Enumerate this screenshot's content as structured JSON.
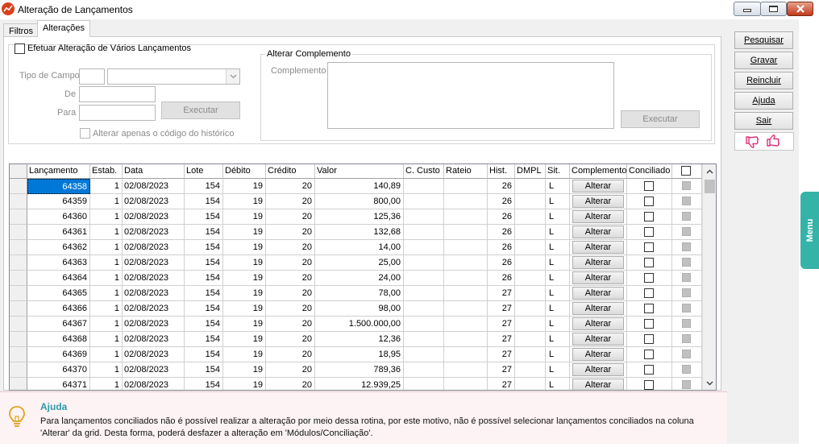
{
  "window": {
    "title": "Alteração de Lançamentos"
  },
  "tabs": [
    {
      "label": "Filtros"
    },
    {
      "label": "Alterações"
    }
  ],
  "form": {
    "multi_checkbox_label": "Efetuar Alteração de Vários Lançamentos",
    "tipo_campo_label": "Tipo de Campo",
    "de_label": "De",
    "para_label": "Para",
    "executar_label": "Executar",
    "historico_checkbox_label": "Alterar apenas o código do histórico",
    "complemento_group_title": "Alterar Complemento",
    "complemento_label": "Complemento",
    "complemento_executar_label": "Executar"
  },
  "grid": {
    "headers": [
      "Lançamento",
      "Estab.",
      "Data",
      "Lote",
      "Débito",
      "Crédito",
      "Valor",
      "C. Custo",
      "Rateio",
      "Hist.",
      "DMPL",
      "Sit.",
      "Complemento",
      "Conciliado"
    ],
    "alterar_label": "Alterar",
    "rows": [
      {
        "lanc": "64358",
        "estab": "1",
        "data": "02/08/2023",
        "lote": "154",
        "debito": "19",
        "credito": "20",
        "valor": "140,89",
        "hist": "26",
        "sit": "L"
      },
      {
        "lanc": "64359",
        "estab": "1",
        "data": "02/08/2023",
        "lote": "154",
        "debito": "19",
        "credito": "20",
        "valor": "800,00",
        "hist": "26",
        "sit": "L"
      },
      {
        "lanc": "64360",
        "estab": "1",
        "data": "02/08/2023",
        "lote": "154",
        "debito": "19",
        "credito": "20",
        "valor": "125,36",
        "hist": "26",
        "sit": "L"
      },
      {
        "lanc": "64361",
        "estab": "1",
        "data": "02/08/2023",
        "lote": "154",
        "debito": "19",
        "credito": "20",
        "valor": "132,68",
        "hist": "26",
        "sit": "L"
      },
      {
        "lanc": "64362",
        "estab": "1",
        "data": "02/08/2023",
        "lote": "154",
        "debito": "19",
        "credito": "20",
        "valor": "14,00",
        "hist": "26",
        "sit": "L"
      },
      {
        "lanc": "64363",
        "estab": "1",
        "data": "02/08/2023",
        "lote": "154",
        "debito": "19",
        "credito": "20",
        "valor": "25,00",
        "hist": "26",
        "sit": "L"
      },
      {
        "lanc": "64364",
        "estab": "1",
        "data": "02/08/2023",
        "lote": "154",
        "debito": "19",
        "credito": "20",
        "valor": "24,00",
        "hist": "26",
        "sit": "L"
      },
      {
        "lanc": "64365",
        "estab": "1",
        "data": "02/08/2023",
        "lote": "154",
        "debito": "19",
        "credito": "20",
        "valor": "78,00",
        "hist": "27",
        "sit": "L"
      },
      {
        "lanc": "64366",
        "estab": "1",
        "data": "02/08/2023",
        "lote": "154",
        "debito": "19",
        "credito": "20",
        "valor": "98,00",
        "hist": "27",
        "sit": "L"
      },
      {
        "lanc": "64367",
        "estab": "1",
        "data": "02/08/2023",
        "lote": "154",
        "debito": "19",
        "credito": "20",
        "valor": "1.500.000,00",
        "hist": "27",
        "sit": "L"
      },
      {
        "lanc": "64368",
        "estab": "1",
        "data": "02/08/2023",
        "lote": "154",
        "debito": "19",
        "credito": "20",
        "valor": "12,36",
        "hist": "27",
        "sit": "L"
      },
      {
        "lanc": "64369",
        "estab": "1",
        "data": "02/08/2023",
        "lote": "154",
        "debito": "19",
        "credito": "20",
        "valor": "18,95",
        "hist": "27",
        "sit": "L"
      },
      {
        "lanc": "64370",
        "estab": "1",
        "data": "02/08/2023",
        "lote": "154",
        "debito": "19",
        "credito": "20",
        "valor": "789,36",
        "hist": "27",
        "sit": "L"
      },
      {
        "lanc": "64371",
        "estab": "1",
        "data": "02/08/2023",
        "lote": "154",
        "debito": "19",
        "credito": "20",
        "valor": "12.939,25",
        "hist": "27",
        "sit": "L"
      }
    ]
  },
  "help": {
    "title": "Ajuda",
    "text": "Para lançamentos conciliados não é possível realizar a alteração por meio dessa rotina, por este motivo, não é possível selecionar lançamentos conciliados na coluna 'Alterar' da grid. Desta forma, poderá desfazer a alteração em 'Módulos/Conciliação'."
  },
  "side_buttons": {
    "pesquisar": "Pesquisar",
    "gravar": "Gravar",
    "reincluir": "Reincluir",
    "ajuda": "Ajuda",
    "sair": "Sair"
  },
  "menu_tab": {
    "label": "Menu"
  },
  "colors": {
    "selection": "#0078d7",
    "menu_tab": "#36b3a8",
    "help_title": "#2a9aa7",
    "feedback_icons": "#e0317c"
  },
  "icons": [
    "app-icon",
    "minimize-icon",
    "maximize-icon",
    "close-icon",
    "chevron-down-icon",
    "lightbulb-icon",
    "thumbs-down-icon",
    "thumbs-up-icon",
    "scroll-up-icon",
    "scroll-down-icon"
  ]
}
